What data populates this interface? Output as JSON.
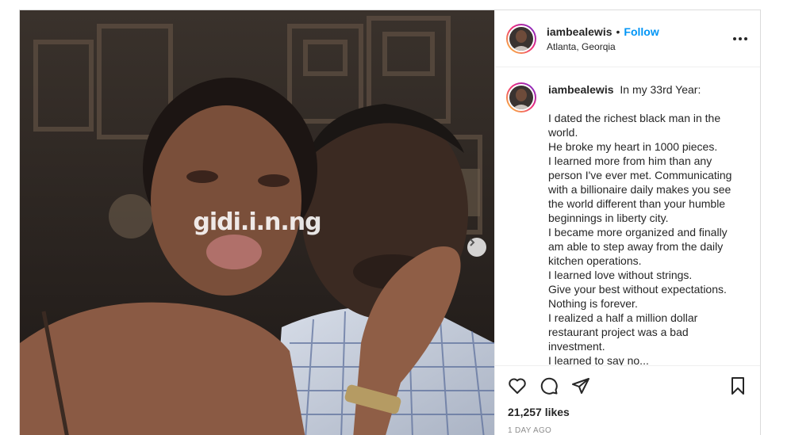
{
  "post": {
    "username": "iambealewis",
    "follow_separator": "•",
    "follow_label": "Follow",
    "location": "Atlanta, Georqia",
    "watermark": "gidi.i.n.ng",
    "caption": {
      "first": "In my 33rd Year:",
      "lines": [
        "I dated the richest black man in the",
        "world.",
        "He broke my heart in 1000 pieces.",
        "I learned more from him than any",
        "person I've ever met. Communicating",
        "with a billionaire daily makes you see",
        "the world different than your humble",
        "beginnings in liberty city.",
        "I became more organized and finally",
        "am able to step away from the daily",
        "kitchen operations.",
        "I learned love without strings.",
        "Give your best without expectations.",
        "Nothing is forever.",
        "I realized a half a million dollar",
        "restaurant project was a bad",
        "investment.",
        "I learned to say no..."
      ]
    },
    "likes": "21,257 likes",
    "time": "1 DAY AGO",
    "icons": {
      "like": "heart-icon",
      "comment": "comment-icon",
      "share": "share-icon",
      "save": "bookmark-icon",
      "more": "more-icon",
      "next": "chevron-right-icon"
    },
    "colors": {
      "follow": "#0095f6",
      "meta": "#8e8e8e",
      "text": "#262626"
    }
  }
}
